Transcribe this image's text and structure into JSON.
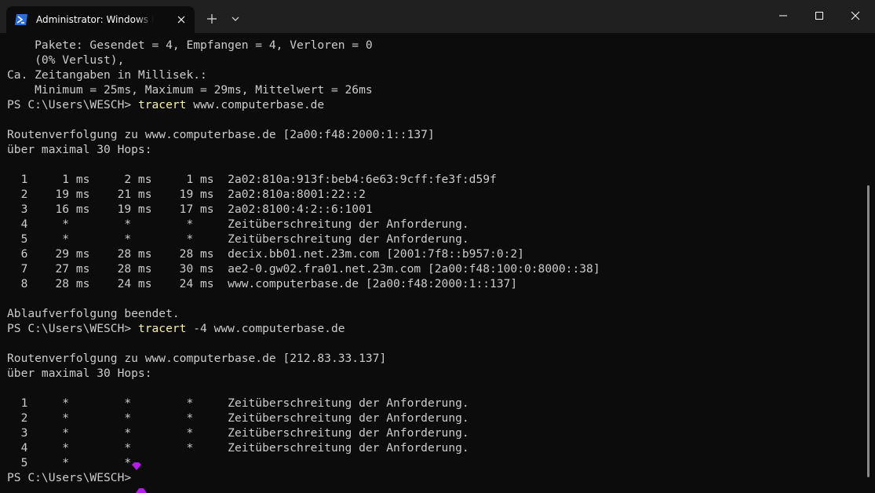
{
  "window": {
    "tab_title": "Administrator: Windows PowerShell",
    "tab_icon": "powershell-icon",
    "new_tab_label": "+",
    "controls": {
      "minimize_icon": "minimize-icon",
      "maximize_icon": "maximize-icon",
      "close_icon": "close-icon"
    },
    "accent_color": "#012456"
  },
  "terminal": {
    "lines": [
      {
        "text": "    Pakete: Gesendet = 4, Empfangen = 4, Verloren = 0"
      },
      {
        "text": "    (0% Verlust),"
      },
      {
        "text": "Ca. Zeitangaben in Millisek.:"
      },
      {
        "text": "    Minimum = 25ms, Maximum = 29ms, Mittelwert = 26ms"
      },
      {
        "prompt": "PS C:\\Users\\WESCH> ",
        "command": "tracert",
        "args": " www.computerbase.de"
      },
      {
        "text": ""
      },
      {
        "text": "Routenverfolgung zu www.computerbase.de [2a00:f48:2000:1::137]"
      },
      {
        "text": "über maximal 30 Hops:"
      },
      {
        "text": ""
      },
      {
        "text": "  1     1 ms     2 ms     1 ms  2a02:810a:913f:beb4:6e63:9cff:fe3f:d59f"
      },
      {
        "text": "  2    19 ms    21 ms    19 ms  2a02:810a:8001:22::2"
      },
      {
        "text": "  3    16 ms    19 ms    17 ms  2a02:8100:4:2::6:1001"
      },
      {
        "text": "  4     *        *        *     Zeitüberschreitung der Anforderung."
      },
      {
        "text": "  5     *        *        *     Zeitüberschreitung der Anforderung."
      },
      {
        "text": "  6    29 ms    28 ms    28 ms  decix.bb01.net.23m.com [2001:7f8::b957:0:2]"
      },
      {
        "text": "  7    27 ms    28 ms    30 ms  ae2-0.gw02.fra01.net.23m.com [2a00:f48:100:0:8000::38]"
      },
      {
        "text": "  8    28 ms    24 ms    24 ms  www.computerbase.de [2a00:f48:2000:1::137]"
      },
      {
        "text": ""
      },
      {
        "text": "Ablaufverfolgung beendet."
      },
      {
        "prompt": "PS C:\\Users\\WESCH> ",
        "command": "tracert",
        "args": " -4 www.computerbase.de"
      },
      {
        "text": ""
      },
      {
        "text": "Routenverfolgung zu www.computerbase.de [212.83.33.137]"
      },
      {
        "text": "über maximal 30 Hops:"
      },
      {
        "text": ""
      },
      {
        "text": "  1     *        *        *     Zeitüberschreitung der Anforderung."
      },
      {
        "text": "  2     *        *        *     Zeitüberschreitung der Anforderung."
      },
      {
        "text": "  3     *        *        *     Zeitüberschreitung der Anforderung."
      },
      {
        "text": "  4     *        *        *     Zeitüberschreitung der Anforderung."
      },
      {
        "text": "  5     *        *"
      },
      {
        "prompt": "PS C:\\Users\\WESCH>",
        "command": "",
        "args": ""
      }
    ],
    "colors": {
      "background": "#0c0c0c",
      "foreground": "#cccccc",
      "command": "#f9f1a5",
      "cursor_marker": "#b01ee8"
    }
  }
}
